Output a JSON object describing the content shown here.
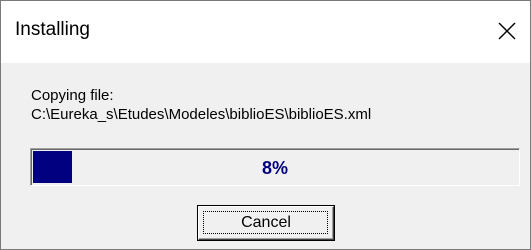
{
  "window": {
    "title": "Installing",
    "close_icon": "close-x-icon"
  },
  "content": {
    "copy_label": "Copying file:",
    "file_path": "C:\\Eureka_s\\Etudes\\Modeles\\biblioES\\biblioES.xml"
  },
  "progress": {
    "percent_label": "8%",
    "value": 0.08,
    "fill_color": "#000080"
  },
  "buttons": {
    "cancel_label": "Cancel"
  }
}
